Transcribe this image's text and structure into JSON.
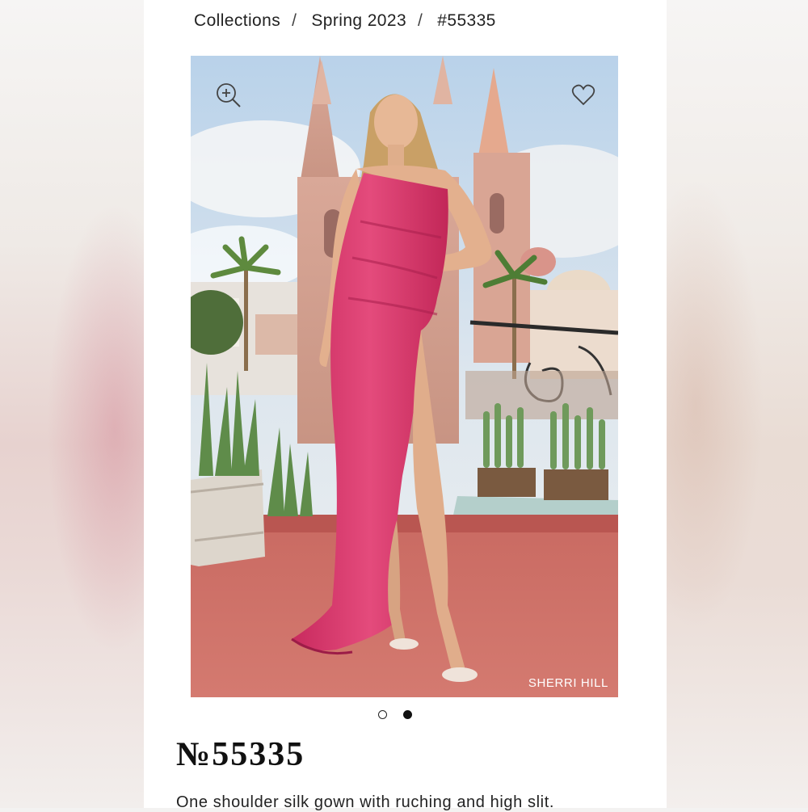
{
  "breadcrumb": {
    "items": [
      "Collections",
      "Spring 2023",
      "#55335"
    ],
    "separator": "/"
  },
  "gallery": {
    "zoom_icon": "zoom-in-icon",
    "favorite_icon": "heart-icon",
    "watermark": "SHERRI HILL",
    "slide_count": 2,
    "active_slide": 2
  },
  "product": {
    "title": "№55335",
    "description": "One shoulder silk gown with ruching and high slit."
  },
  "colors": {
    "dress": "#d8336a",
    "floor": "#c9605c",
    "sky": "#c9dcec"
  }
}
